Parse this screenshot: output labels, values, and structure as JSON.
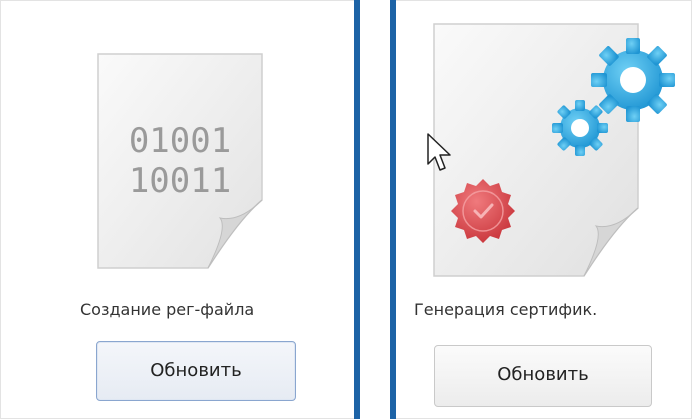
{
  "tiles": [
    {
      "icon": "binary-document-icon",
      "binary_lines": [
        "01001",
        "10011"
      ],
      "label": "Создание рег-файла",
      "button_label": "Обновить"
    },
    {
      "icon": "certificate-gears-icon",
      "label": "Генерация сертифик.",
      "button_label": "Обновить"
    }
  ],
  "cursor": "arrow-cursor-icon",
  "colors": {
    "divider": "#1d63a6",
    "gear": "#29a9e1",
    "seal": "#e0474c"
  }
}
